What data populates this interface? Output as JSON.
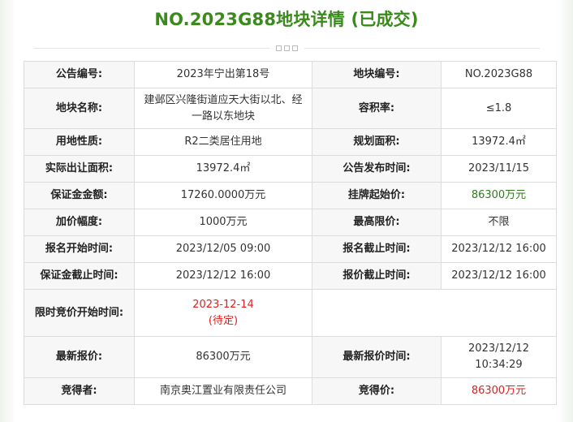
{
  "page": {
    "title": "NO.2023G88地块详情 (已成交)"
  },
  "rows": {
    "announcement_no": {
      "label": "公告编号:",
      "value": "2023年宁出第18号"
    },
    "plot_no": {
      "label": "地块编号:",
      "value": "NO.2023G88"
    },
    "plot_name": {
      "label": "地块名称:",
      "value": "建邺区兴隆街道应天大街以北、经一路以东地块"
    },
    "plot_ratio": {
      "label": "容积率:",
      "value": "≤1.8"
    },
    "land_use": {
      "label": "用地性质:",
      "value": "R2二类居住用地"
    },
    "planned_area": {
      "label": "规划面积:",
      "value": "13972.4㎡"
    },
    "transfer_area": {
      "label": "实际出让面积:",
      "value": "13972.4㎡"
    },
    "publish_time": {
      "label": "公告发布时间:",
      "value": "2023/11/15"
    },
    "deposit": {
      "label": "保证金金额:",
      "value": "17260.0000万元"
    },
    "starting_price": {
      "label": "挂牌起始价:",
      "value": "86300万元"
    },
    "increment": {
      "label": "加价幅度:",
      "value": "1000万元"
    },
    "price_cap": {
      "label": "最高限价:",
      "value": "不限"
    },
    "reg_start": {
      "label": "报名开始时间:",
      "value": "2023/12/05 09:00"
    },
    "reg_end": {
      "label": "报名截止时间:",
      "value": "2023/12/12 16:00"
    },
    "deposit_deadline": {
      "label": "保证金截止时间:",
      "value": "2023/12/12 16:00"
    },
    "bid_deadline": {
      "label": "报价截止时间:",
      "value": "2023/12/12 16:00"
    },
    "timed_bid_start": {
      "label": "限时竞价开始时间:",
      "value": "2023-12-14",
      "note": "(待定)"
    },
    "latest_bid": {
      "label": "最新报价:",
      "value": "86300万元"
    },
    "latest_bid_time": {
      "label": "最新报价时间:",
      "value": "2023/12/12",
      "time": "10:34:29"
    },
    "winner": {
      "label": "竞得者:",
      "value": "南京奥江置业有限责任公司"
    },
    "winning_price": {
      "label": "竞得价:",
      "value": "86300万元"
    }
  },
  "colors": {
    "title": "#3a8a1c",
    "highlight_green": "#2e7d1a",
    "highlight_red": "#e02020"
  }
}
